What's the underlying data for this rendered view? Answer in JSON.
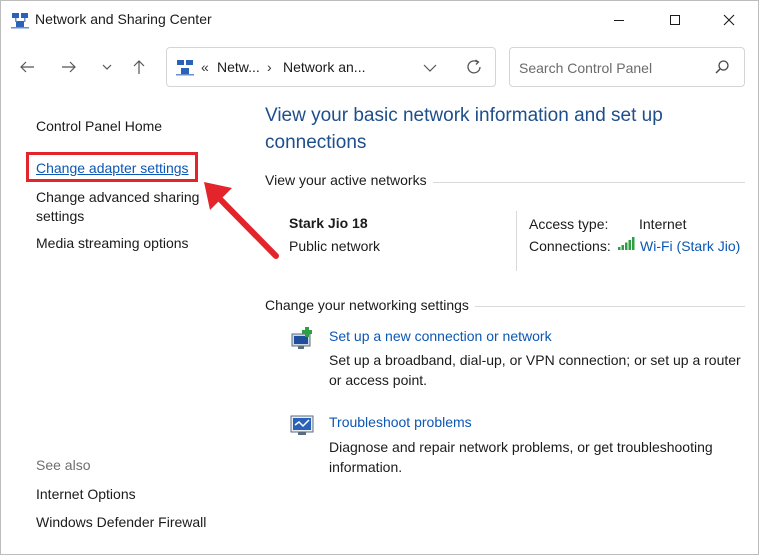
{
  "window": {
    "title": "Network and Sharing Center"
  },
  "nav": {
    "breadcrumb_overflow": "«",
    "breadcrumbs": [
      "Netw...",
      "Network an..."
    ],
    "search_placeholder": "Search Control Panel"
  },
  "sidebar": {
    "home": "Control Panel Home",
    "links": [
      "Change adapter settings",
      "Change advanced sharing settings",
      "Media streaming options"
    ],
    "see_also_title": "See also",
    "see_also": [
      "Internet Options",
      "Windows Defender Firewall"
    ]
  },
  "main": {
    "heading": "View your basic network information and set up connections",
    "active_networks_label": "View your active networks",
    "network": {
      "name": "Stark Jio 18",
      "type": "Public network",
      "access_type_label": "Access type:",
      "access_type_value": "Internet",
      "connections_label": "Connections:",
      "connections_value": "Wi-Fi (Stark Jio)"
    },
    "change_settings_label": "Change your networking settings",
    "tasks": [
      {
        "title": "Set up a new connection or network",
        "desc": "Set up a broadband, dial-up, or VPN connection; or set up a router or access point."
      },
      {
        "title": "Troubleshoot problems",
        "desc": "Diagnose and repair network problems, or get troubleshooting information."
      }
    ]
  },
  "colors": {
    "link": "#0b57b5",
    "heading": "#1e4e8c",
    "highlight": "#e3242b",
    "wifi": "#2ea043"
  },
  "icons": [
    "network-center-icon",
    "minimize-icon",
    "maximize-icon",
    "close-icon",
    "back-arrow-icon",
    "forward-arrow-icon",
    "chevron-down-icon",
    "up-arrow-icon",
    "refresh-icon",
    "search-icon",
    "wifi-signal-icon",
    "new-connection-icon",
    "troubleshoot-icon",
    "red-arrow-annotation"
  ]
}
